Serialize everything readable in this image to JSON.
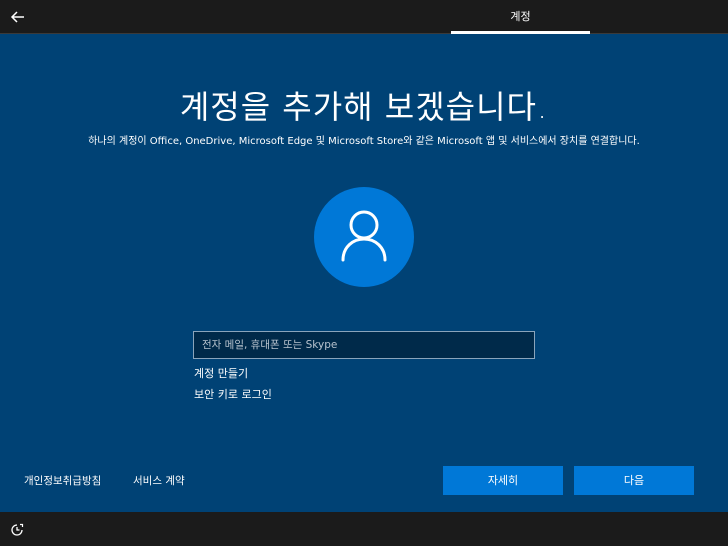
{
  "header": {
    "back_icon": "back-arrow-icon",
    "tab_label": "계정"
  },
  "main": {
    "title": "계정을 추가해 보겠습니다.",
    "subtitle": "하나의 계정이 Office, OneDrive, Microsoft Edge 및 Microsoft Store와 같은 Microsoft 앱 및 서비스에서 장치를 연결합니다.",
    "avatar_icon": "user-icon",
    "email_placeholder": "전자 메일, 휴대폰 또는 Skype",
    "email_value": "",
    "create_account_link": "계정 만들기",
    "security_key_link": "보안 키로 로그인"
  },
  "footer": {
    "privacy_link": "개인정보취급방침",
    "service_link": "서비스 계약",
    "learn_more_button": "자세히",
    "next_button": "다음"
  },
  "bottom": {
    "accessibility_icon": "accessibility-icon"
  },
  "colors": {
    "background": "#004275",
    "bar": "#1b1b1b",
    "accent": "#0078d7"
  }
}
